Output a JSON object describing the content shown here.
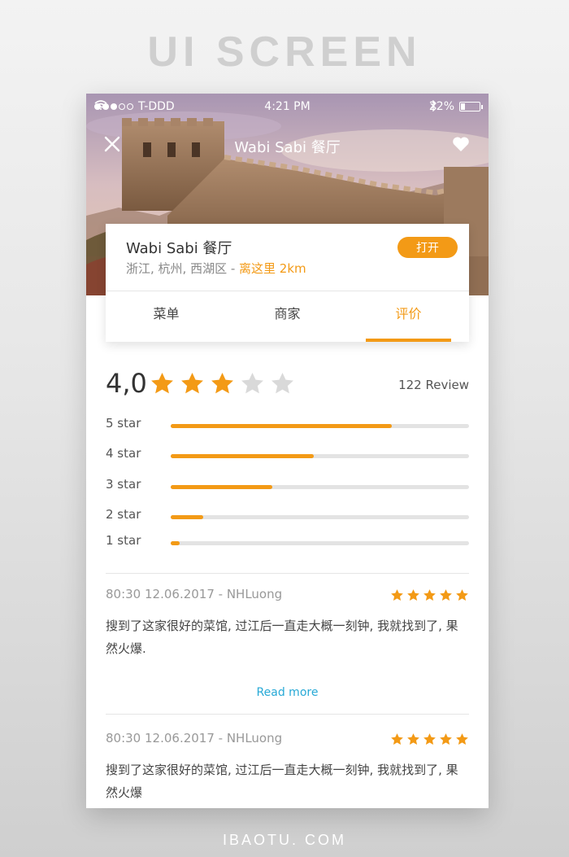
{
  "page_heading": "UI SCREEN",
  "footer_watermark": "IBAOTU. COM",
  "status_bar": {
    "carrier": "T-DDD",
    "time": "4:21 PM",
    "battery_percent": "22%",
    "battery_level": 0.22,
    "signal_dots_filled": 3
  },
  "nav": {
    "title": "Wabi Sabi 餐厅",
    "close_icon": "close-icon",
    "favorite_icon": "heart-icon"
  },
  "shop": {
    "name": "Wabi Sabi 餐厅",
    "location": "浙江, 杭州, 西湖区 - ",
    "distance": "离这里 2km",
    "open_label": "打开"
  },
  "tabs": [
    {
      "label": "菜单",
      "active": false
    },
    {
      "label": "商家",
      "active": false
    },
    {
      "label": "评价",
      "active": true
    }
  ],
  "rating": {
    "score": "4,0",
    "stars_filled": 3,
    "stars_total": 5,
    "review_count": "122 Review"
  },
  "distribution": [
    {
      "label": "5 star",
      "fraction": 0.74
    },
    {
      "label": "4 star",
      "fraction": 0.48
    },
    {
      "label": "3 star",
      "fraction": 0.34
    },
    {
      "label": "2 star",
      "fraction": 0.11
    },
    {
      "label": "1 star",
      "fraction": 0.03
    }
  ],
  "reviews": [
    {
      "meta": "80:30 12.06.2017 - NHLuong",
      "stars": 5,
      "text": "搜到了这家很好的菜馆, 过江后一直走大概一刻钟, 我就找到了, 果然火爆.",
      "read_more": "Read more"
    },
    {
      "meta": "80:30 12.06.2017 - NHLuong",
      "stars": 5,
      "text": "搜到了这家很好的菜馆, 过江后一直走大概一刻钟, 我就找到了, 果然火爆"
    }
  ],
  "colors": {
    "accent": "#f39a16",
    "link": "#27a9d6",
    "star_empty": "#d9d9d9"
  }
}
